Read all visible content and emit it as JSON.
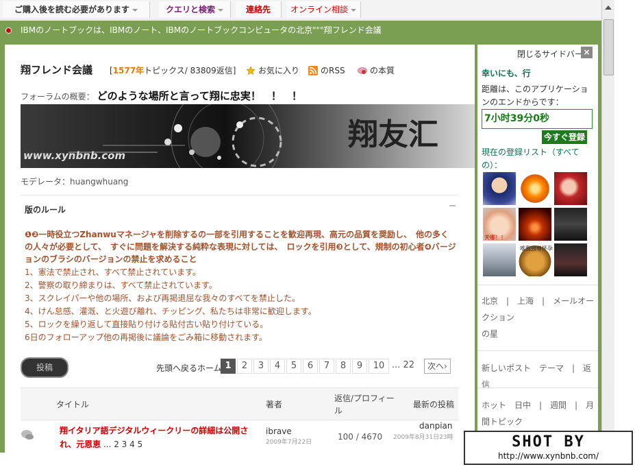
{
  "topnav": {
    "tabs": [
      {
        "label": "ご購入後を読む必要があります",
        "color": "#333333",
        "caret": true
      },
      {
        "label": "クエリと検索",
        "color": "#7a1a7a",
        "caret": true
      },
      {
        "label": "連絡先",
        "color": "#cc0000",
        "caret": false
      },
      {
        "label": "オンライン相談",
        "color": "#cc0000",
        "caret": true
      }
    ]
  },
  "notice": {
    "text": "IBMのノートブックは、IBMのノート、IBMのノートブックコンピュータの北京\"\"\"翔フレンド会議"
  },
  "forum": {
    "title": "翔フレンド会議",
    "stats_open": "[",
    "topics": "1577年",
    "stats_rest": "トピックス/ 83809返信]",
    "favorite": "お気に入り",
    "rss": "のRSS",
    "essence": "の本質",
    "desc_label": "フォーラムの概要：",
    "desc_text": "どのような場所と言って翔に忠実！　！　！",
    "banner_text": "翔友汇",
    "banner_url": "www.xynbnb.com",
    "moderator": "モデレータ：huangwhuang"
  },
  "rules": {
    "title": "版のルール",
    "bold_text": "❶❷一時役立つZhanwuマネージャを削除するの一部を引用することを歓迎再現、高元の品質を奨励し、　他の多くの人々が必要として、　すぐに問題を解決する純粋な表現に対しては、　ロックを引用❸として、規制の初心者❹バージョンのブラシのバージョンの禁止を求めること",
    "lines": [
      "1、憲法で禁止され、すべて禁止されています。",
      "2、警察の取り締まりは、すべて禁止されています。",
      "3、スクレイパーや他の場所、および再掲退屈な我々のすべてを禁止した。",
      "4、けん怠感、灌漑、と火遊び離れ、チッピング、私たちは非常に歓迎します。",
      "5、ロックを繰り返して直接貼り付ける貼付古い貼り付けている。",
      "6日のフォローアップ他の再掲後に議論をごみ箱に移動されます。"
    ]
  },
  "pager": {
    "post_button": "投稿",
    "label": "先頭へ戻るホーム",
    "pages": [
      "1",
      "2",
      "3",
      "4",
      "5",
      "6",
      "7",
      "8",
      "9",
      "10"
    ],
    "ellipsis_last": "... 22",
    "next": "次へ›"
  },
  "table": {
    "headers": {
      "title": "タイトル",
      "author": "著者",
      "replies": "返信/プロフィール",
      "last": "最新の投稿"
    },
    "rows": [
      {
        "title": "翔イタリア語デジタルウィークリーの詳細は公開され、元恩恵",
        "pages": " ... 2 3 4 5",
        "author": "ibrave",
        "date": "2009年7月22日",
        "counts": "100 / 4670",
        "last_author": "danpian",
        "last_date": "2009年8月31日23時"
      }
    ]
  },
  "sidebar": {
    "close_label": "閉じるサイドバー",
    "close_x": "×",
    "lucky": "幸いにも、行",
    "distance": "距離は、このアプリケーションのエンドからです：",
    "timer": "7小时39分0秒",
    "login": "今すぐ登録",
    "online_prefix": "現在の登録リスト",
    "online_all": "（すべての）：",
    "avatar_captions": [
      "天哪！！",
      "唯我独尊怀孕"
    ],
    "city_links": "北京　|　上海　|　メールオークション",
    "city_suffix": "の星",
    "post_links": "新しいポスト　テーマ　|　返信",
    "hot_links": "ホット　日中　|　週間　|　月間トピック"
  },
  "watermark": {
    "title": "SHOT BY",
    "url": "http://www.xynbnb.com/"
  },
  "colors": {
    "green": "#7a9e52",
    "orange": "#e07b00",
    "red": "#cc0000",
    "rule_brown": "#a0522d",
    "timer_green": "#147a14"
  }
}
